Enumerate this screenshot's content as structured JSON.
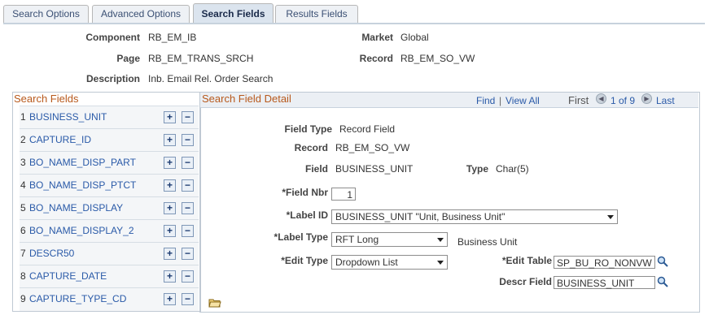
{
  "tabs": [
    {
      "label": "Search Options"
    },
    {
      "label": "Advanced Options"
    },
    {
      "label": "Search Fields"
    },
    {
      "label": "Results Fields"
    }
  ],
  "header": {
    "component_label": "Component",
    "component_value": "RB_EM_IB",
    "page_label": "Page",
    "page_value": "RB_EM_TRANS_SRCH",
    "description_label": "Description",
    "description_value": "Inb. Email Rel. Order Search",
    "market_label": "Market",
    "market_value": "Global",
    "record_label": "Record",
    "record_value": "RB_EM_SO_VW"
  },
  "search_fields": {
    "title": "Search Fields",
    "rows": [
      {
        "num": "1",
        "name": "BUSINESS_UNIT"
      },
      {
        "num": "2",
        "name": "CAPTURE_ID"
      },
      {
        "num": "3",
        "name": "BO_NAME_DISP_PART"
      },
      {
        "num": "4",
        "name": "BO_NAME_DISP_PTCT"
      },
      {
        "num": "5",
        "name": "BO_NAME_DISPLAY"
      },
      {
        "num": "6",
        "name": "BO_NAME_DISPLAY_2"
      },
      {
        "num": "7",
        "name": "DESCR50"
      },
      {
        "num": "8",
        "name": "CAPTURE_DATE"
      },
      {
        "num": "9",
        "name": "CAPTURE_TYPE_CD"
      }
    ],
    "add_symbol": "+",
    "remove_symbol": "−"
  },
  "detail": {
    "title": "Search Field Detail",
    "nav": {
      "find": "Find",
      "sep": "|",
      "view_all": "View All",
      "first": "First",
      "position": "1 of 9",
      "last": "Last"
    },
    "field_type_label": "Field Type",
    "field_type_value": "Record Field",
    "record_label": "Record",
    "record_value": "RB_EM_SO_VW",
    "field_label": "Field",
    "field_value": "BUSINESS_UNIT",
    "type_label": "Type",
    "type_value": "Char(5)",
    "field_nbr_label": "*Field Nbr",
    "field_nbr_value": "1",
    "label_id_label": "*Label ID",
    "label_id_value": "BUSINESS_UNIT \"Unit, Business Unit\"",
    "label_type_label": "*Label Type",
    "label_type_value": "RFT Long",
    "label_text": "Business Unit",
    "edit_type_label": "*Edit Type",
    "edit_type_value": "Dropdown List",
    "edit_table_label": "*Edit Table",
    "edit_table_value": "SP_BU_RO_NONVW",
    "descr_field_label": "Descr Field",
    "descr_field_value": "BUSINESS_UNIT"
  }
}
